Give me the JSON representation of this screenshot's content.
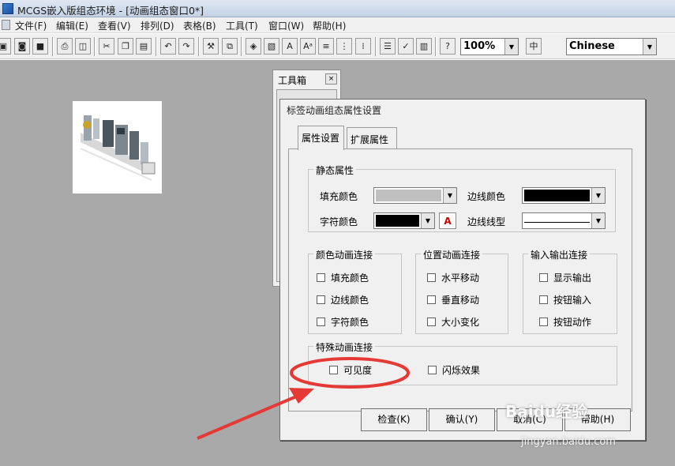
{
  "window": {
    "title": "MCGS嵌入版组态环境 - [动画组态窗口0*]"
  },
  "menu": [
    {
      "label": "文件(F)",
      "icon": "none"
    },
    {
      "label": "编辑(E)"
    },
    {
      "label": "查看(V)"
    },
    {
      "label": "排列(D)"
    },
    {
      "label": "表格(B)"
    },
    {
      "label": "工具(T)"
    },
    {
      "label": "窗口(W)"
    },
    {
      "label": "帮助(H)"
    }
  ],
  "toolbar": {
    "zoom_value": "100%",
    "language_value": "Chinese"
  },
  "toolbox": {
    "title": "工具箱",
    "close": "×"
  },
  "dialog": {
    "title": "标签动画组态属性设置",
    "tabs": [
      "属性设置",
      "扩展属性"
    ],
    "static": {
      "legend": "静态属性",
      "fill_color_label": "填充颜色",
      "border_color_label": "边线颜色",
      "text_color_label": "字符颜色",
      "border_style_label": "边线线型",
      "font_button": "A",
      "fill_color": "#c0c0c0",
      "border_color": "#000000",
      "text_color": "#000000"
    },
    "color_anim": {
      "legend": "颜色动画连接",
      "items": [
        "填充颜色",
        "边线颜色",
        "字符颜色"
      ]
    },
    "position_anim": {
      "legend": "位置动画连接",
      "items": [
        "水平移动",
        "垂直移动",
        "大小变化"
      ]
    },
    "io": {
      "legend": "输入输出连接",
      "items": [
        "显示输出",
        "按钮输入",
        "按钮动作"
      ]
    },
    "special": {
      "legend": "特殊动画连接",
      "items": [
        "可见度",
        "闪烁效果"
      ]
    },
    "buttons": {
      "check": "检查(K)",
      "ok": "确认(Y)",
      "cancel": "取消(C)",
      "help": "帮助(H)"
    }
  },
  "watermark": {
    "text": "Baidu经验",
    "url": "jingyan.baidu.com"
  },
  "colors": {
    "annotation": "#e53935",
    "workspace": "#a9a9a9"
  }
}
